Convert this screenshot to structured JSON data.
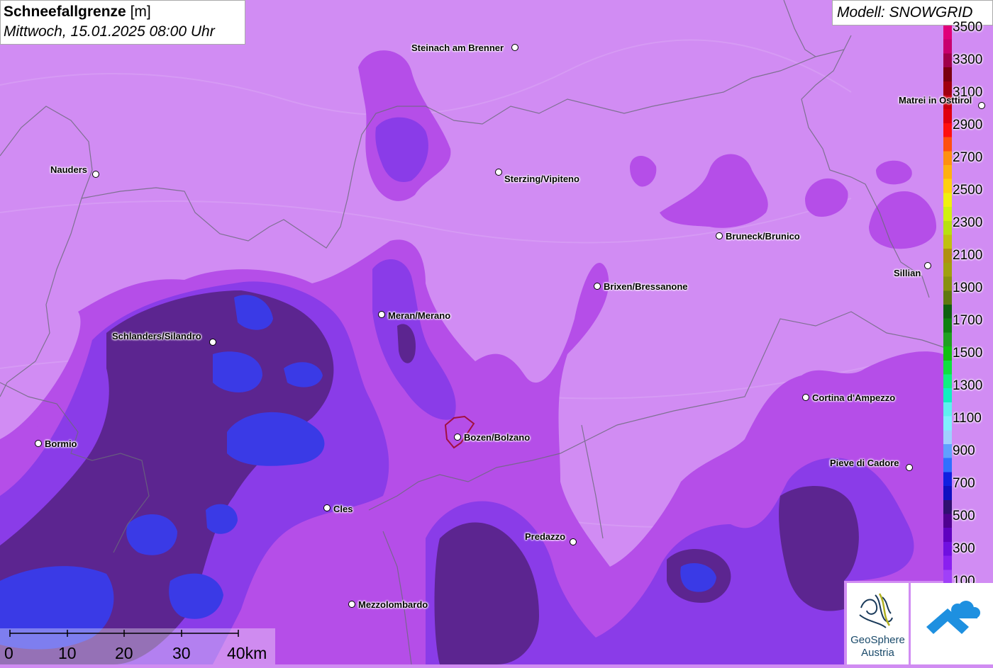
{
  "header": {
    "title_bold": "Schneefallgrenze",
    "title_unit": "[m]",
    "datetime": "Mittwoch, 15.01.2025 08:00 Uhr"
  },
  "model": {
    "label": "Modell: SNOWGRID"
  },
  "legend": {
    "labels": [
      "3500",
      "3300",
      "3100",
      "2900",
      "2700",
      "2500",
      "2300",
      "2100",
      "1900",
      "1700",
      "1500",
      "1300",
      "1100",
      "900",
      "700",
      "500",
      "300",
      "100"
    ],
    "colors": [
      "#e0007a",
      "#c8006e",
      "#a0004a",
      "#7a0010",
      "#a00010",
      "#c80010",
      "#e00010",
      "#ff1010",
      "#ff5010",
      "#ff9010",
      "#ffb010",
      "#ffd010",
      "#f0f010",
      "#d0f010",
      "#b8e010",
      "#c0c010",
      "#b09010",
      "#a0a010",
      "#889010",
      "#607810",
      "#106010",
      "#108010",
      "#20a020",
      "#10c010",
      "#10e040",
      "#10f080",
      "#10f0c0",
      "#60f0f0",
      "#80f0ff",
      "#a0d0ff",
      "#60a0ff",
      "#3070ff",
      "#1020e0",
      "#1010c0",
      "#301070",
      "#500090",
      "#6000c0",
      "#7010e0",
      "#8a20f0",
      "#a040f8"
    ]
  },
  "map": {
    "base_color": "#d08cf2",
    "cities": [
      {
        "name": "Steinach am Brenner"
      },
      {
        "name": "Nauders"
      },
      {
        "name": "Sterzing/Vipiteno"
      },
      {
        "name": "Matrei in Osttirol"
      },
      {
        "name": "Bruneck/Brunico"
      },
      {
        "name": "Sillian"
      },
      {
        "name": "Brixen/Bressanone"
      },
      {
        "name": "Meran/Merano"
      },
      {
        "name": "Schlanders/Silandro"
      },
      {
        "name": "Cortina d'Ampezzo"
      },
      {
        "name": "Bormio"
      },
      {
        "name": "Bozen/Bolzano"
      },
      {
        "name": "Pieve di Cadore"
      },
      {
        "name": "Cles"
      },
      {
        "name": "Predazzo"
      },
      {
        "name": "Mezzolombardo"
      }
    ]
  },
  "scale": {
    "labels": [
      "0",
      "10",
      "20",
      "30",
      "40km"
    ]
  },
  "logo": {
    "line1": "GeoSphere",
    "line2": "Austria"
  }
}
